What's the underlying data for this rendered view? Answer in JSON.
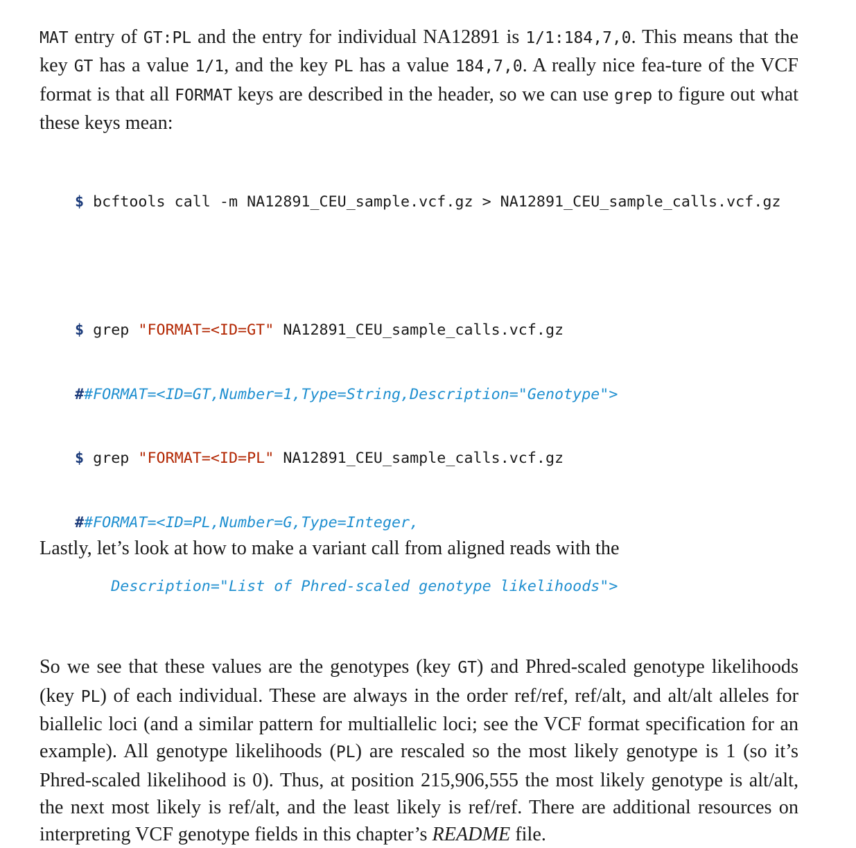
{
  "para1": {
    "s0": "MAT",
    "s1": " entry of ",
    "s2": "GT:PL",
    "s3": " and the entry for individual NA12891 is ",
    "s4": "1/1:184,7,0",
    "s5": ". This means that the key ",
    "s6": "GT",
    "s7": " has a value ",
    "s8": "1/1",
    "s9": ", and the key ",
    "s10": "PL",
    "s11": " has a value ",
    "s12": "184,7,0",
    "s13": ". A really nice fea-ture of the VCF format is that all ",
    "s14": "FORMAT",
    "s15": " keys are described in the header, so we can use ",
    "s16": "grep",
    "s17": " to figure out what these keys mean:"
  },
  "code": {
    "prompt": "$",
    "line1": " bcftools call -m NA12891_CEU_sample.vcf.gz > NA12891_CEU_sample_calls.vcf.gz",
    "line2_cmd": " grep ",
    "line2_str": "\"FORMAT=<ID=GT\"",
    "line2_file": " NA12891_CEU_sample_calls.vcf.gz",
    "line3_hash": "#",
    "line3": "#FORMAT=<ID=GT,Number=1,Type=String,Description=\"Genotype\">",
    "line4_cmd": " grep ",
    "line4_str": "\"FORMAT=<ID=PL\"",
    "line4_file": " NA12891_CEU_sample_calls.vcf.gz",
    "line5_hash": "#",
    "line5": "#FORMAT=<ID=PL,Number=G,Type=Integer,",
    "line6": "    Description=\"List of Phred-scaled genotype likelihoods\">"
  },
  "para2": {
    "s0": "So we see that these values are the genotypes (key ",
    "s1": "GT",
    "s2": ") and Phred-scaled genotype likelihoods (key ",
    "s3": "PL",
    "s4": ") of each individual. These are always in the order ref/ref, ref/alt, and alt/alt alleles for biallelic loci (and a similar pattern for multiallelic loci; see the VCF format specification for an example). All genotype likelihoods (",
    "s5": "PL",
    "s6": ") are rescaled so the most likely genotype is 1 (so it’s Phred-scaled likelihood is 0). Thus, at position 215,906,555 the most likely genotype is alt/alt, the next most likely is ref/alt, and the least likely is ref/ref. There are additional resources on interpreting VCF genotype fields in this chapter’s ",
    "s7": "README",
    "s8": " file."
  },
  "cutoff_text": "Lastly, let’s look at how to make a variant call from aligned reads with the"
}
